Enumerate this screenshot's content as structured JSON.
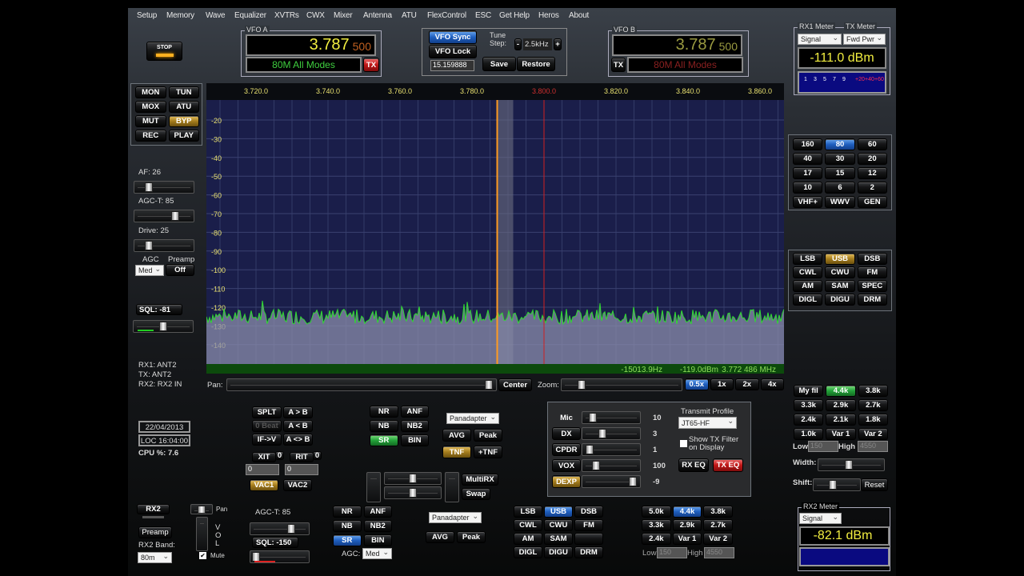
{
  "menu": [
    "Setup",
    "Memory",
    "Wave",
    "Equalizer",
    "XVTRs",
    "CWX",
    "Mixer",
    "Antenna",
    "ATU",
    "FlexControl",
    "ESC",
    "Get Help",
    "Heros",
    "About"
  ],
  "stop": "STOP",
  "vfoa": {
    "title": "VFO A",
    "freq": "3.787",
    "sub": "500",
    "band": "80M All Modes",
    "tx": "TX"
  },
  "vfob": {
    "title": "VFO B",
    "freq": "3.787",
    "sub": "500",
    "band": "80M All Modes",
    "tx": "TX"
  },
  "center": {
    "sync": "VFO Sync",
    "lock": "VFO Lock",
    "freq_field": "15.159888",
    "tune_label": "Tune Step:",
    "minus": "-",
    "step": "2.5kHz",
    "plus": "+",
    "save": "Save",
    "restore": "Restore"
  },
  "meter1": {
    "rx_label": "RX1 Meter",
    "tx_label": "TX Meter",
    "rx_sel": "Signal",
    "tx_sel": "Fwd Pwr",
    "reading": "-111.0 dBm",
    "scale": [
      "1",
      "3",
      "5",
      "7",
      "9",
      "+20",
      "+40",
      "+60"
    ]
  },
  "meter2": {
    "label": "RX2 Meter",
    "sel": "Signal",
    "reading": "-82.1 dBm"
  },
  "left_buttons": [
    {
      "label": "MON"
    },
    {
      "label": "TUN"
    },
    {
      "label": "MOX"
    },
    {
      "label": "ATU"
    },
    {
      "label": "MUT"
    },
    {
      "label": "BYP",
      "state": "gold"
    },
    {
      "label": "REC"
    },
    {
      "label": "PLAY"
    }
  ],
  "af": {
    "label": "AF:",
    "value": "26",
    "pos": 0.2
  },
  "agct": {
    "label": "AGC-T:",
    "value": "85",
    "pos": 0.72
  },
  "drive": {
    "label": "Drive:",
    "value": "25",
    "pos": 0.2
  },
  "agc": {
    "label": "AGC",
    "value": "Med",
    "preamp_label": "Preamp",
    "preamp": "Off"
  },
  "sql": {
    "label": "SQL: -81",
    "pos": 0.5
  },
  "antennas": [
    "RX1: ANT2",
    "TX: ANT2",
    "RX2: RX2 IN"
  ],
  "date": "22/04/2013",
  "time": "LOC 16:04:00",
  "cpu": "CPU %: 7.6",
  "bands": [
    {
      "label": "160"
    },
    {
      "label": "80",
      "state": "blue"
    },
    {
      "label": "60"
    },
    {
      "label": "40"
    },
    {
      "label": "30"
    },
    {
      "label": "20"
    },
    {
      "label": "17"
    },
    {
      "label": "15"
    },
    {
      "label": "12"
    },
    {
      "label": "10"
    },
    {
      "label": "6"
    },
    {
      "label": "2"
    },
    {
      "label": "VHF+"
    },
    {
      "label": "WWV"
    },
    {
      "label": "GEN"
    }
  ],
  "modes": [
    {
      "label": "LSB"
    },
    {
      "label": "USB",
      "state": "gold"
    },
    {
      "label": "DSB"
    },
    {
      "label": "CWL"
    },
    {
      "label": "CWU"
    },
    {
      "label": "FM"
    },
    {
      "label": "AM"
    },
    {
      "label": "SAM"
    },
    {
      "label": "SPEC"
    },
    {
      "label": "DIGL"
    },
    {
      "label": "DIGU"
    },
    {
      "label": "DRM"
    }
  ],
  "spectrum": {
    "freq_ticks": [
      "3.720.0",
      "3.740.0",
      "3.760.0",
      "3.780.0",
      "3.800.0",
      "3.820.0",
      "3.840.0",
      "3.860.0"
    ],
    "freq_values": [
      3.72,
      3.74,
      3.76,
      3.78,
      3.8,
      3.82,
      3.84,
      3.86
    ],
    "db_ticks": [
      "-20",
      "-30",
      "-40",
      "-50",
      "-60",
      "-70",
      "-80",
      "-90",
      "-100",
      "-110",
      "-120",
      "-130",
      "-140"
    ],
    "vfo_freq": 3.787,
    "band_edge": 3.8,
    "noise_floor": -125,
    "colors": {
      "trace": "#2fdc2f",
      "vfo": "#ff9a20",
      "edge": "#d02020"
    },
    "status": {
      "offset": "-15013.9Hz",
      "level": "-119.0dBm",
      "freq": "3.772 486 MHz"
    }
  },
  "pan": {
    "label": "Pan:",
    "center": "Center",
    "pos": 0.99
  },
  "zoom": {
    "label": "Zoom:",
    "pos": 0.14,
    "buttons": [
      {
        "label": "0.5x",
        "state": "blue"
      },
      {
        "label": "1x"
      },
      {
        "label": "2x"
      },
      {
        "label": "4x"
      }
    ]
  },
  "vfo_ops": [
    {
      "label": "SPLT"
    },
    {
      "label": "A > B"
    },
    {
      "label": "0 Beat",
      "state": "dim"
    },
    {
      "label": "A < B"
    },
    {
      "label": "IF->V"
    },
    {
      "label": "A <> B"
    }
  ],
  "xit": {
    "label": "XIT",
    "val": "0",
    "field": "0"
  },
  "rit": {
    "label": "RIT",
    "val": "0",
    "field": "0"
  },
  "vac": [
    {
      "label": "VAC1",
      "state": "gold"
    },
    {
      "label": "VAC2"
    }
  ],
  "dsp1": [
    {
      "label": "NR"
    },
    {
      "label": "ANF"
    },
    {
      "label": "NB"
    },
    {
      "label": "NB2"
    },
    {
      "label": "SR",
      "state": "green"
    },
    {
      "label": "BIN"
    }
  ],
  "display1": {
    "sel": "Panadapter",
    "avg": "AVG",
    "peak": "Peak",
    "tnf": "TNF",
    "ptnf": "+TNF"
  },
  "multirx": "MultiRX",
  "swap": "Swap",
  "tx": {
    "rows": [
      {
        "label": "Mic",
        "value": "10",
        "pos": 0.12
      },
      {
        "label": "DX",
        "value": "3",
        "pos": 0.3
      },
      {
        "label": "CPDR",
        "value": "1",
        "pos": 0.05
      },
      {
        "label": "VOX",
        "value": "100",
        "pos": 0.18
      },
      {
        "label": "DEXP",
        "value": "-9",
        "pos": 0.92,
        "state": "gold"
      }
    ],
    "profile_label": "Transmit Profile",
    "profile": "JT65-HF",
    "show_filter": "Show TX Filter on Display",
    "rxeq": "RX EQ",
    "txeq": "TX EQ"
  },
  "filters1": [
    {
      "label": "My fil"
    },
    {
      "label": "4.4k",
      "state": "green"
    },
    {
      "label": "3.8k"
    },
    {
      "label": "3.3k"
    },
    {
      "label": "2.9k"
    },
    {
      "label": "2.7k"
    },
    {
      "label": "2.4k"
    },
    {
      "label": "2.1k"
    },
    {
      "label": "1.8k"
    },
    {
      "label": "1.0k"
    },
    {
      "label": "Var 1"
    },
    {
      "label": "Var 2"
    }
  ],
  "filt1": {
    "low_label": "Low",
    "low": "150",
    "high_label": "High",
    "high": "4550",
    "width_label": "Width:",
    "shift_label": "Shift:",
    "reset": "Reset",
    "width_pos": 0.45,
    "shift_pos": 0.4
  },
  "rx2": {
    "rx2": "RX2",
    "preamp": "Preamp",
    "band_label": "RX2 Band:",
    "band": "80m",
    "pan": "Pan",
    "vol": "VOL",
    "mute": "Mute",
    "agct": "AGC-T:  85",
    "sql": "SQL: -150",
    "agc_label": "AGC:",
    "agc": "Med"
  },
  "dsp2": [
    {
      "label": "NR"
    },
    {
      "label": "ANF"
    },
    {
      "label": "NB"
    },
    {
      "label": "NB2"
    },
    {
      "label": "SR",
      "state": "blue"
    },
    {
      "label": "BIN"
    }
  ],
  "display2": {
    "sel": "Panadapter",
    "avg": "AVG",
    "peak": "Peak"
  },
  "modes2": [
    {
      "label": "LSB"
    },
    {
      "label": "USB",
      "state": "blue"
    },
    {
      "label": "DSB"
    },
    {
      "label": "CWL"
    },
    {
      "label": "CWU"
    },
    {
      "label": "FM"
    },
    {
      "label": "AM"
    },
    {
      "label": "SAM"
    },
    {
      "label": ""
    },
    {
      "label": "DIGL"
    },
    {
      "label": "DIGU"
    },
    {
      "label": "DRM"
    }
  ],
  "filters2": [
    {
      "label": "5.0k"
    },
    {
      "label": "4.4k",
      "state": "blue"
    },
    {
      "label": "3.8k"
    },
    {
      "label": "3.3k"
    },
    {
      "label": "2.9k"
    },
    {
      "label": "2.7k"
    },
    {
      "label": "2.4k"
    },
    {
      "label": "Var 1"
    },
    {
      "label": "Var 2"
    }
  ],
  "filt2": {
    "low_label": "Low",
    "low": "150",
    "high_label": "High",
    "high": "4550"
  }
}
